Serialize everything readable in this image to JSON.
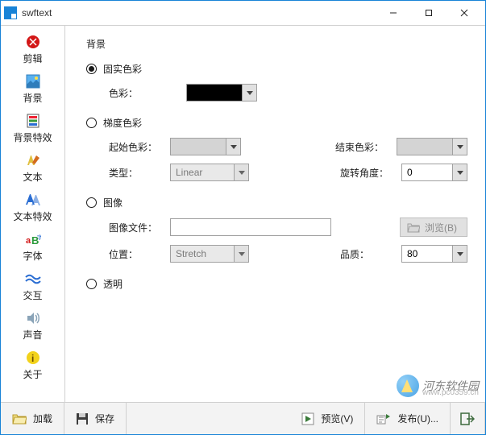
{
  "title": "swftext",
  "sidebar": [
    {
      "label": "剪辑"
    },
    {
      "label": "背景"
    },
    {
      "label": "背景特效"
    },
    {
      "label": "文本"
    },
    {
      "label": "文本特效"
    },
    {
      "label": "字体"
    },
    {
      "label": "交互"
    },
    {
      "label": "声音"
    },
    {
      "label": "关于"
    }
  ],
  "main": {
    "section_title": "背景",
    "radios": {
      "solid": "固实色彩",
      "gradient": "梯度色彩",
      "image": "图像",
      "transparent": "透明"
    },
    "labels": {
      "color": "色彩：",
      "start_color": "起始色彩：",
      "end_color": "结束色彩：",
      "type": "类型：",
      "angle": "旋转角度：",
      "image_file": "图像文件：",
      "position": "位置：",
      "quality": "品质："
    },
    "values": {
      "gradient_type": "Linear",
      "angle": "0",
      "position": "Stretch",
      "quality": "80",
      "image_file": "",
      "solid_color": "#000000"
    },
    "browse_label": "浏览(B)"
  },
  "footer": {
    "load": "加载",
    "save": "保存",
    "preview": "预览(V)",
    "publish": "发布(U)..."
  },
  "watermark": {
    "text": "河东软件园",
    "sub": "www.pc0359.cn"
  }
}
